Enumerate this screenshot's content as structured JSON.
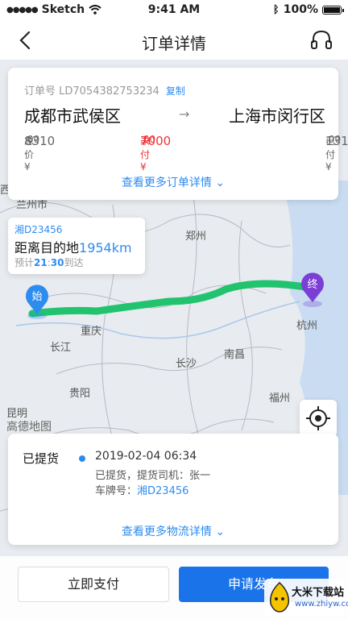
{
  "status_bar": {
    "carrier": "Sketch",
    "time": "9:41 AM",
    "battery_percent": "100%"
  },
  "nav": {
    "title": "订单详情"
  },
  "order": {
    "order_no": "订单号 LD7054382753234",
    "copy_label": "复制",
    "origin": "成都市武侯区",
    "destination": "上海市闵行区",
    "total_label": "总价 ¥",
    "total_int": "8310",
    "total_dec": ".00",
    "unpaid_label": "未付 ¥",
    "unpaid_int": "7000",
    "unpaid_dec": ".00",
    "paid_label": "已付 ¥",
    "paid_int": "1310",
    "paid_dec": ".00",
    "more_label": "查看更多订单详情"
  },
  "distance_card": {
    "plate": "湘D23456",
    "main_label": "距离目的地",
    "distance": "1954km",
    "eta_prefix": "预计",
    "eta_hour": "21",
    "eta_sep": ":",
    "eta_minute": "30",
    "eta_suffix": "到达"
  },
  "map": {
    "start_marker": "始",
    "end_marker": "终",
    "provider": "高德地图",
    "cities": {
      "lanzhou": "兰州市",
      "zhengzhou": "郑州",
      "chongqing": "重庆",
      "changjiang": "长江",
      "changsha": "长沙",
      "nanchang": "南昌",
      "hangzhou": "杭州",
      "guiyang": "贵阳",
      "fuzhou": "福州",
      "kunming": "昆明",
      "xi": "西"
    },
    "route_color": "#21c36f",
    "end_marker_color": "#7b3fd6",
    "start_marker_color": "#2d8cf0"
  },
  "logistics": {
    "status": "已提货",
    "time": "2019-02-04 06:34",
    "description": "已提货，提货司机：张一",
    "plate_label": "车牌号：",
    "plate_value": "湘D23456",
    "more_label": "查看更多物流详情"
  },
  "actions": {
    "pay_label": "立即支付",
    "ship_label": "申请发车"
  },
  "watermark": {
    "title": "大米下载站",
    "site": "www.zhiyw.com"
  },
  "colors": {
    "accent": "#2d8cf0",
    "primary_button": "#1a73e8",
    "unpaid": "#e33333"
  }
}
